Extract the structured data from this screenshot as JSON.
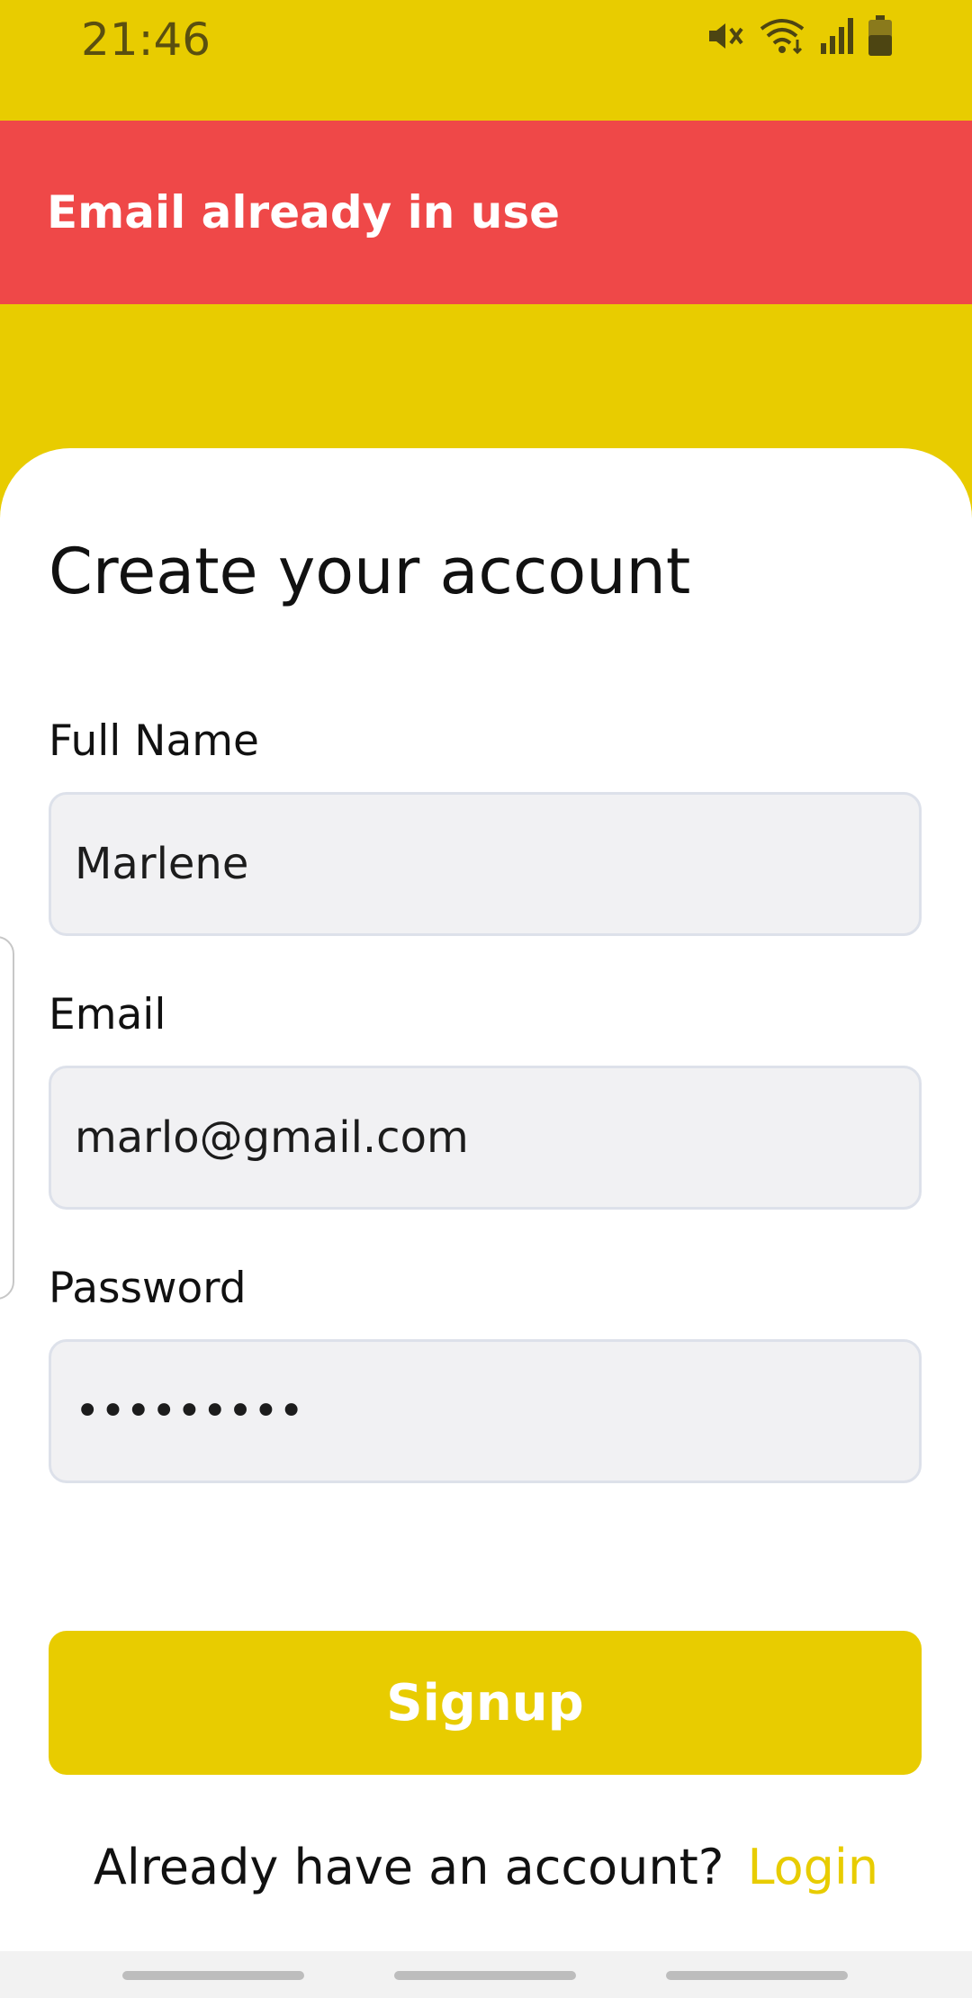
{
  "status_bar": {
    "time": "21:46",
    "icons": [
      "mute-icon",
      "wifi-icon",
      "signal-icon",
      "battery-icon"
    ]
  },
  "snackbar": {
    "message": "Email already in use",
    "color": "#EF4848"
  },
  "form": {
    "title": "Create your account",
    "full_name": {
      "label": "Full Name",
      "value": "Marlene"
    },
    "email": {
      "label": "Email",
      "value": "marlo@gmail.com"
    },
    "password": {
      "label": "Password",
      "value": "•••••••••"
    },
    "signup_label": "Signup",
    "login_prompt": "Already have an account?",
    "login_link": "Login"
  },
  "theme": {
    "accent": "#E8CC00",
    "error": "#EF4848",
    "input_bg": "#F1F1F3"
  }
}
